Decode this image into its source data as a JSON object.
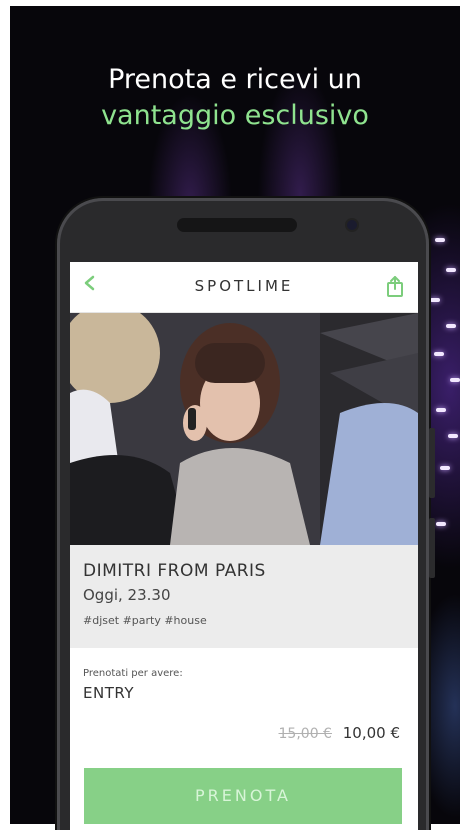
{
  "promo": {
    "headline_line1": "Prenota e ricevi un",
    "headline_line2": "vantaggio esclusivo",
    "headline_color": "#ffffff",
    "accent_color": "#8fe38f"
  },
  "app": {
    "title": "SPOTLIME",
    "back_icon": "chevron-left-icon",
    "share_icon": "share-icon",
    "brand_color": "#7ccd7c"
  },
  "event": {
    "name": "DIMITRI FROM PARIS",
    "time": "Oggi, 23.30",
    "tags": "#djset #party #house"
  },
  "booking": {
    "label": "Prenotati per avere:",
    "value": "ENTRY",
    "old_price": "15,00 €",
    "new_price": "10,00 €"
  },
  "cta": {
    "label": "PRENOTA",
    "color": "#87d087"
  }
}
